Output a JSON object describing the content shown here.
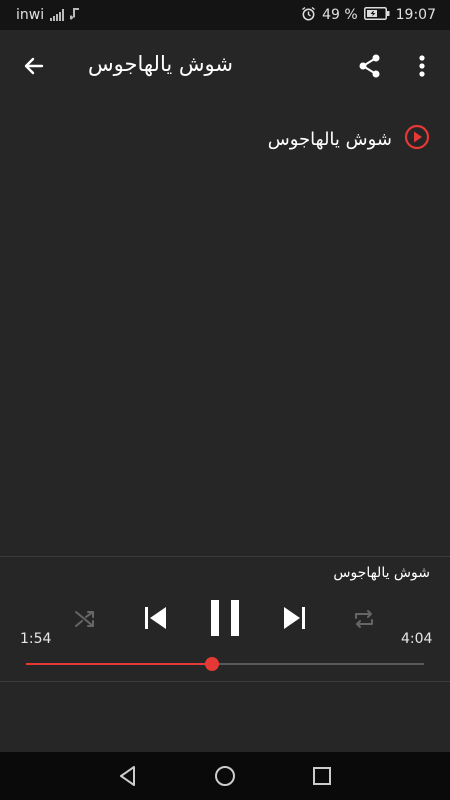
{
  "status_bar": {
    "carrier": "inwi",
    "battery_percent": "49 %",
    "time": "19:07",
    "icons": [
      "signal-icon",
      "music-note-icon",
      "alarm-icon",
      "battery-charging-icon"
    ]
  },
  "app_bar": {
    "title": "شوش يالهاجوس",
    "icons": [
      "back-arrow-icon",
      "share-icon",
      "more-vert-icon"
    ]
  },
  "track_list": [
    {
      "title": "شوش يالهاجوس",
      "icon": "play-circle-icon"
    }
  ],
  "player": {
    "now_playing": "شوش يالهاجوس",
    "elapsed": "1:54",
    "duration": "4:04",
    "progress": 0.467,
    "state": "playing",
    "shuffle_enabled": false,
    "repeat_enabled": false
  },
  "nav_bar": {
    "icons": [
      "back-triangle-icon",
      "home-circle-icon",
      "recents-square-icon"
    ]
  },
  "colors": {
    "accent": "#e53935",
    "background": "#262626",
    "status_bar": "#141414",
    "nav_bar": "#0a0a0a"
  }
}
